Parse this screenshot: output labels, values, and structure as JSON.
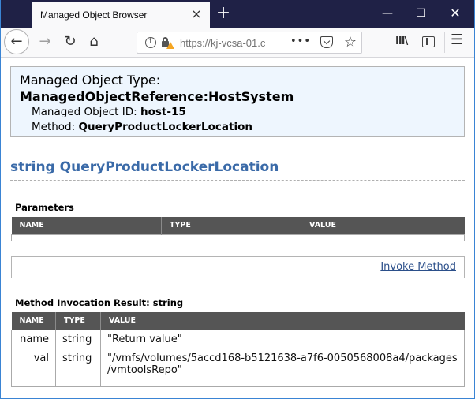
{
  "browser": {
    "tab_title": "Managed Object Browser",
    "tab_close_icon": "×",
    "new_tab_icon": "+",
    "window_controls": {
      "minimize": "—",
      "maximize": "☐",
      "close": "✕"
    },
    "nav": {
      "back": "←",
      "forward": "→",
      "reload": "↻",
      "home": "⌂"
    },
    "url": "https://kj-vcsa-01.c",
    "url_more": "•••",
    "star_icon": "☆",
    "library_icon": "III\\",
    "menu_icon": "☰"
  },
  "object": {
    "type_label": "Managed Object Type:",
    "type_value": "ManagedObjectReference:HostSystem",
    "id_label": "Managed Object ID:",
    "id_value": "host-15",
    "method_label": "Method:",
    "method_value": "QueryProductLockerLocation"
  },
  "method_title": "string QueryProductLockerLocation",
  "parameters": {
    "heading": "Parameters",
    "columns": [
      "NAME",
      "TYPE",
      "VALUE"
    ],
    "rows": []
  },
  "invoke": {
    "label": "Invoke Method"
  },
  "result": {
    "heading": "Method Invocation Result: string",
    "columns": [
      "NAME",
      "TYPE",
      "VALUE"
    ],
    "rows": [
      {
        "name": "name",
        "type": "string",
        "value": "\"Return value\""
      },
      {
        "name": "val",
        "type": "string",
        "value": "\"/vmfs/volumes/5accd168-b5121638-a7f6-0050568008a4/packages /vmtoolsRepo\""
      }
    ]
  }
}
